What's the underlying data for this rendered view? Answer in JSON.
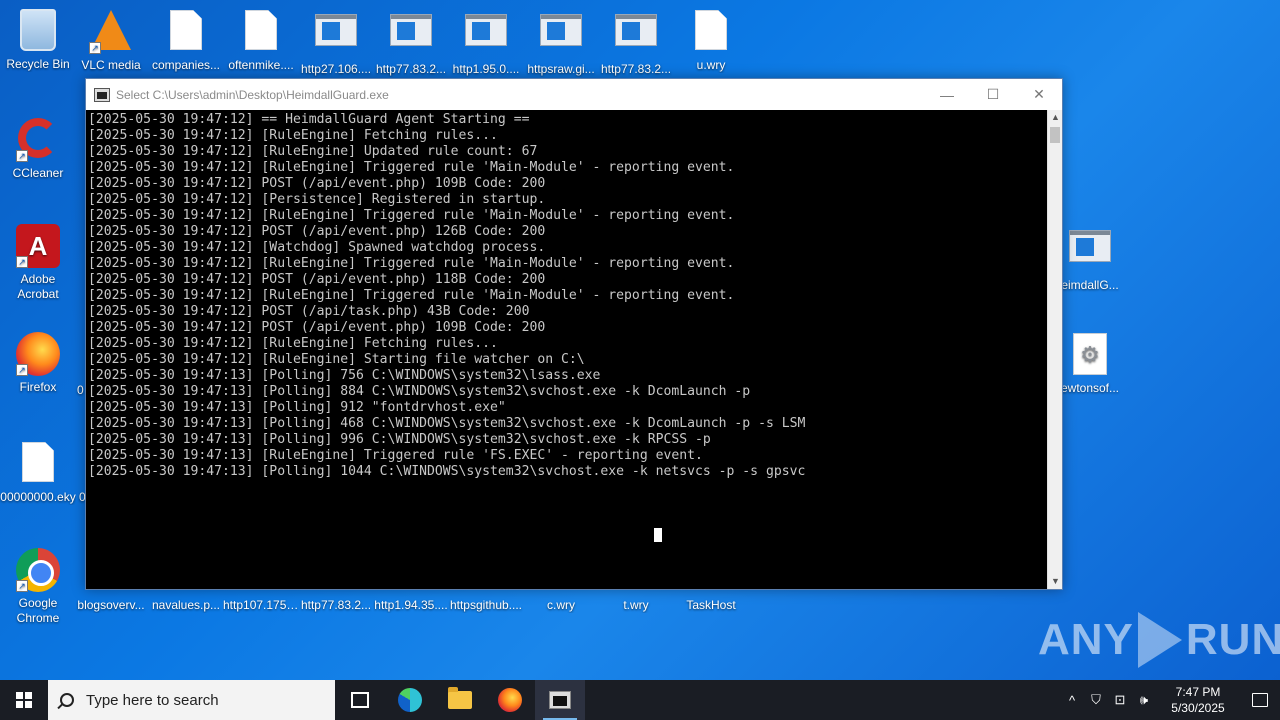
{
  "desktop": {
    "top_icons": [
      {
        "label": "Recycle Bin",
        "icon": "recycle-bin-icon"
      },
      {
        "label": "VLC media",
        "icon": "vlc-icon"
      },
      {
        "label": "companies...",
        "icon": "file-icon"
      },
      {
        "label": "oftenmike....",
        "icon": "file-icon"
      },
      {
        "label": "http27.106....",
        "icon": "window-file-icon"
      },
      {
        "label": "http77.83.2...",
        "icon": "window-file-icon"
      },
      {
        "label": "http1.95.0....",
        "icon": "window-file-icon"
      },
      {
        "label": "httpsraw.gi...",
        "icon": "window-file-icon"
      },
      {
        "label": "http77.83.2...",
        "icon": "window-file-icon"
      },
      {
        "label": "u.wry",
        "icon": "file-icon"
      }
    ],
    "left_icons": [
      {
        "label": "CCleaner",
        "icon": "ccleaner-icon"
      },
      {
        "label": "Adobe Acrobat",
        "icon": "acrobat-icon"
      },
      {
        "label": "Firefox",
        "icon": "firefox-icon"
      },
      {
        "label": "00000000.eky",
        "icon": "file-icon"
      },
      {
        "label": "Google Chrome",
        "icon": "chrome-icon"
      }
    ],
    "bottom_icons": [
      {
        "label": "blogsoverv..."
      },
      {
        "label": "navalues.p..."
      },
      {
        "label": "http107.175...."
      },
      {
        "label": "http77.83.2..."
      },
      {
        "label": "http1.94.35...."
      },
      {
        "label": "httpsgithub...."
      },
      {
        "label": "c.wry"
      },
      {
        "label": "t.wry"
      },
      {
        "label": "TaskHost"
      }
    ],
    "right_icons": [
      {
        "label": "eimdallG...",
        "icon": "window-file-icon"
      },
      {
        "label": "ewtonsof...",
        "icon": "gear-file-icon"
      }
    ],
    "partial_labels": [
      "0",
      "0"
    ]
  },
  "window": {
    "title": "Select C:\\Users\\admin\\Desktop\\HeimdallGuard.exe",
    "controls": {
      "minimize": "—",
      "maximize": "☐",
      "close": "✕"
    },
    "console_lines": [
      "[2025-05-30 19:47:12] == HeimdallGuard Agent Starting ==",
      "[2025-05-30 19:47:12] [RuleEngine] Fetching rules...",
      "[2025-05-30 19:47:12] [RuleEngine] Updated rule count: 67",
      "[2025-05-30 19:47:12] [RuleEngine] Triggered rule 'Main-Module' - reporting event.",
      "[2025-05-30 19:47:12] POST (/api/event.php) 109B Code: 200",
      "[2025-05-30 19:47:12] [Persistence] Registered in startup.",
      "[2025-05-30 19:47:12] [RuleEngine] Triggered rule 'Main-Module' - reporting event.",
      "[2025-05-30 19:47:12] POST (/api/event.php) 126B Code: 200",
      "[2025-05-30 19:47:12] [Watchdog] Spawned watchdog process.",
      "[2025-05-30 19:47:12] [RuleEngine] Triggered rule 'Main-Module' - reporting event.",
      "[2025-05-30 19:47:12] POST (/api/event.php) 118B Code: 200",
      "[2025-05-30 19:47:12] [RuleEngine] Triggered rule 'Main-Module' - reporting event.",
      "[2025-05-30 19:47:12] POST (/api/task.php) 43B Code: 200",
      "[2025-05-30 19:47:12] POST (/api/event.php) 109B Code: 200",
      "[2025-05-30 19:47:12] [RuleEngine] Fetching rules...",
      "[2025-05-30 19:47:12] [RuleEngine] Starting file watcher on C:\\",
      "[2025-05-30 19:47:13] [Polling] 756 C:\\WINDOWS\\system32\\lsass.exe",
      "[2025-05-30 19:47:13] [Polling] 884 C:\\WINDOWS\\system32\\svchost.exe -k DcomLaunch -p",
      "[2025-05-30 19:47:13] [Polling] 912 \"fontdrvhost.exe\"",
      "[2025-05-30 19:47:13] [Polling] 468 C:\\WINDOWS\\system32\\svchost.exe -k DcomLaunch -p -s LSM",
      "[2025-05-30 19:47:13] [Polling] 996 C:\\WINDOWS\\system32\\svchost.exe -k RPCSS -p",
      "[2025-05-30 19:47:13] [RuleEngine] Triggered rule 'FS.EXEC' - reporting event.",
      "[2025-05-30 19:47:13] [Polling] 1044 C:\\WINDOWS\\system32\\svchost.exe -k netsvcs -p -s gpsvc"
    ]
  },
  "watermark": {
    "left": "ANY",
    "right": "RUN"
  },
  "taskbar": {
    "search_placeholder": "Type here to search",
    "time": "7:47 PM",
    "date": "5/30/2025",
    "tray": {
      "chevron": "^",
      "network": "⊡",
      "speaker": "🕪"
    }
  }
}
